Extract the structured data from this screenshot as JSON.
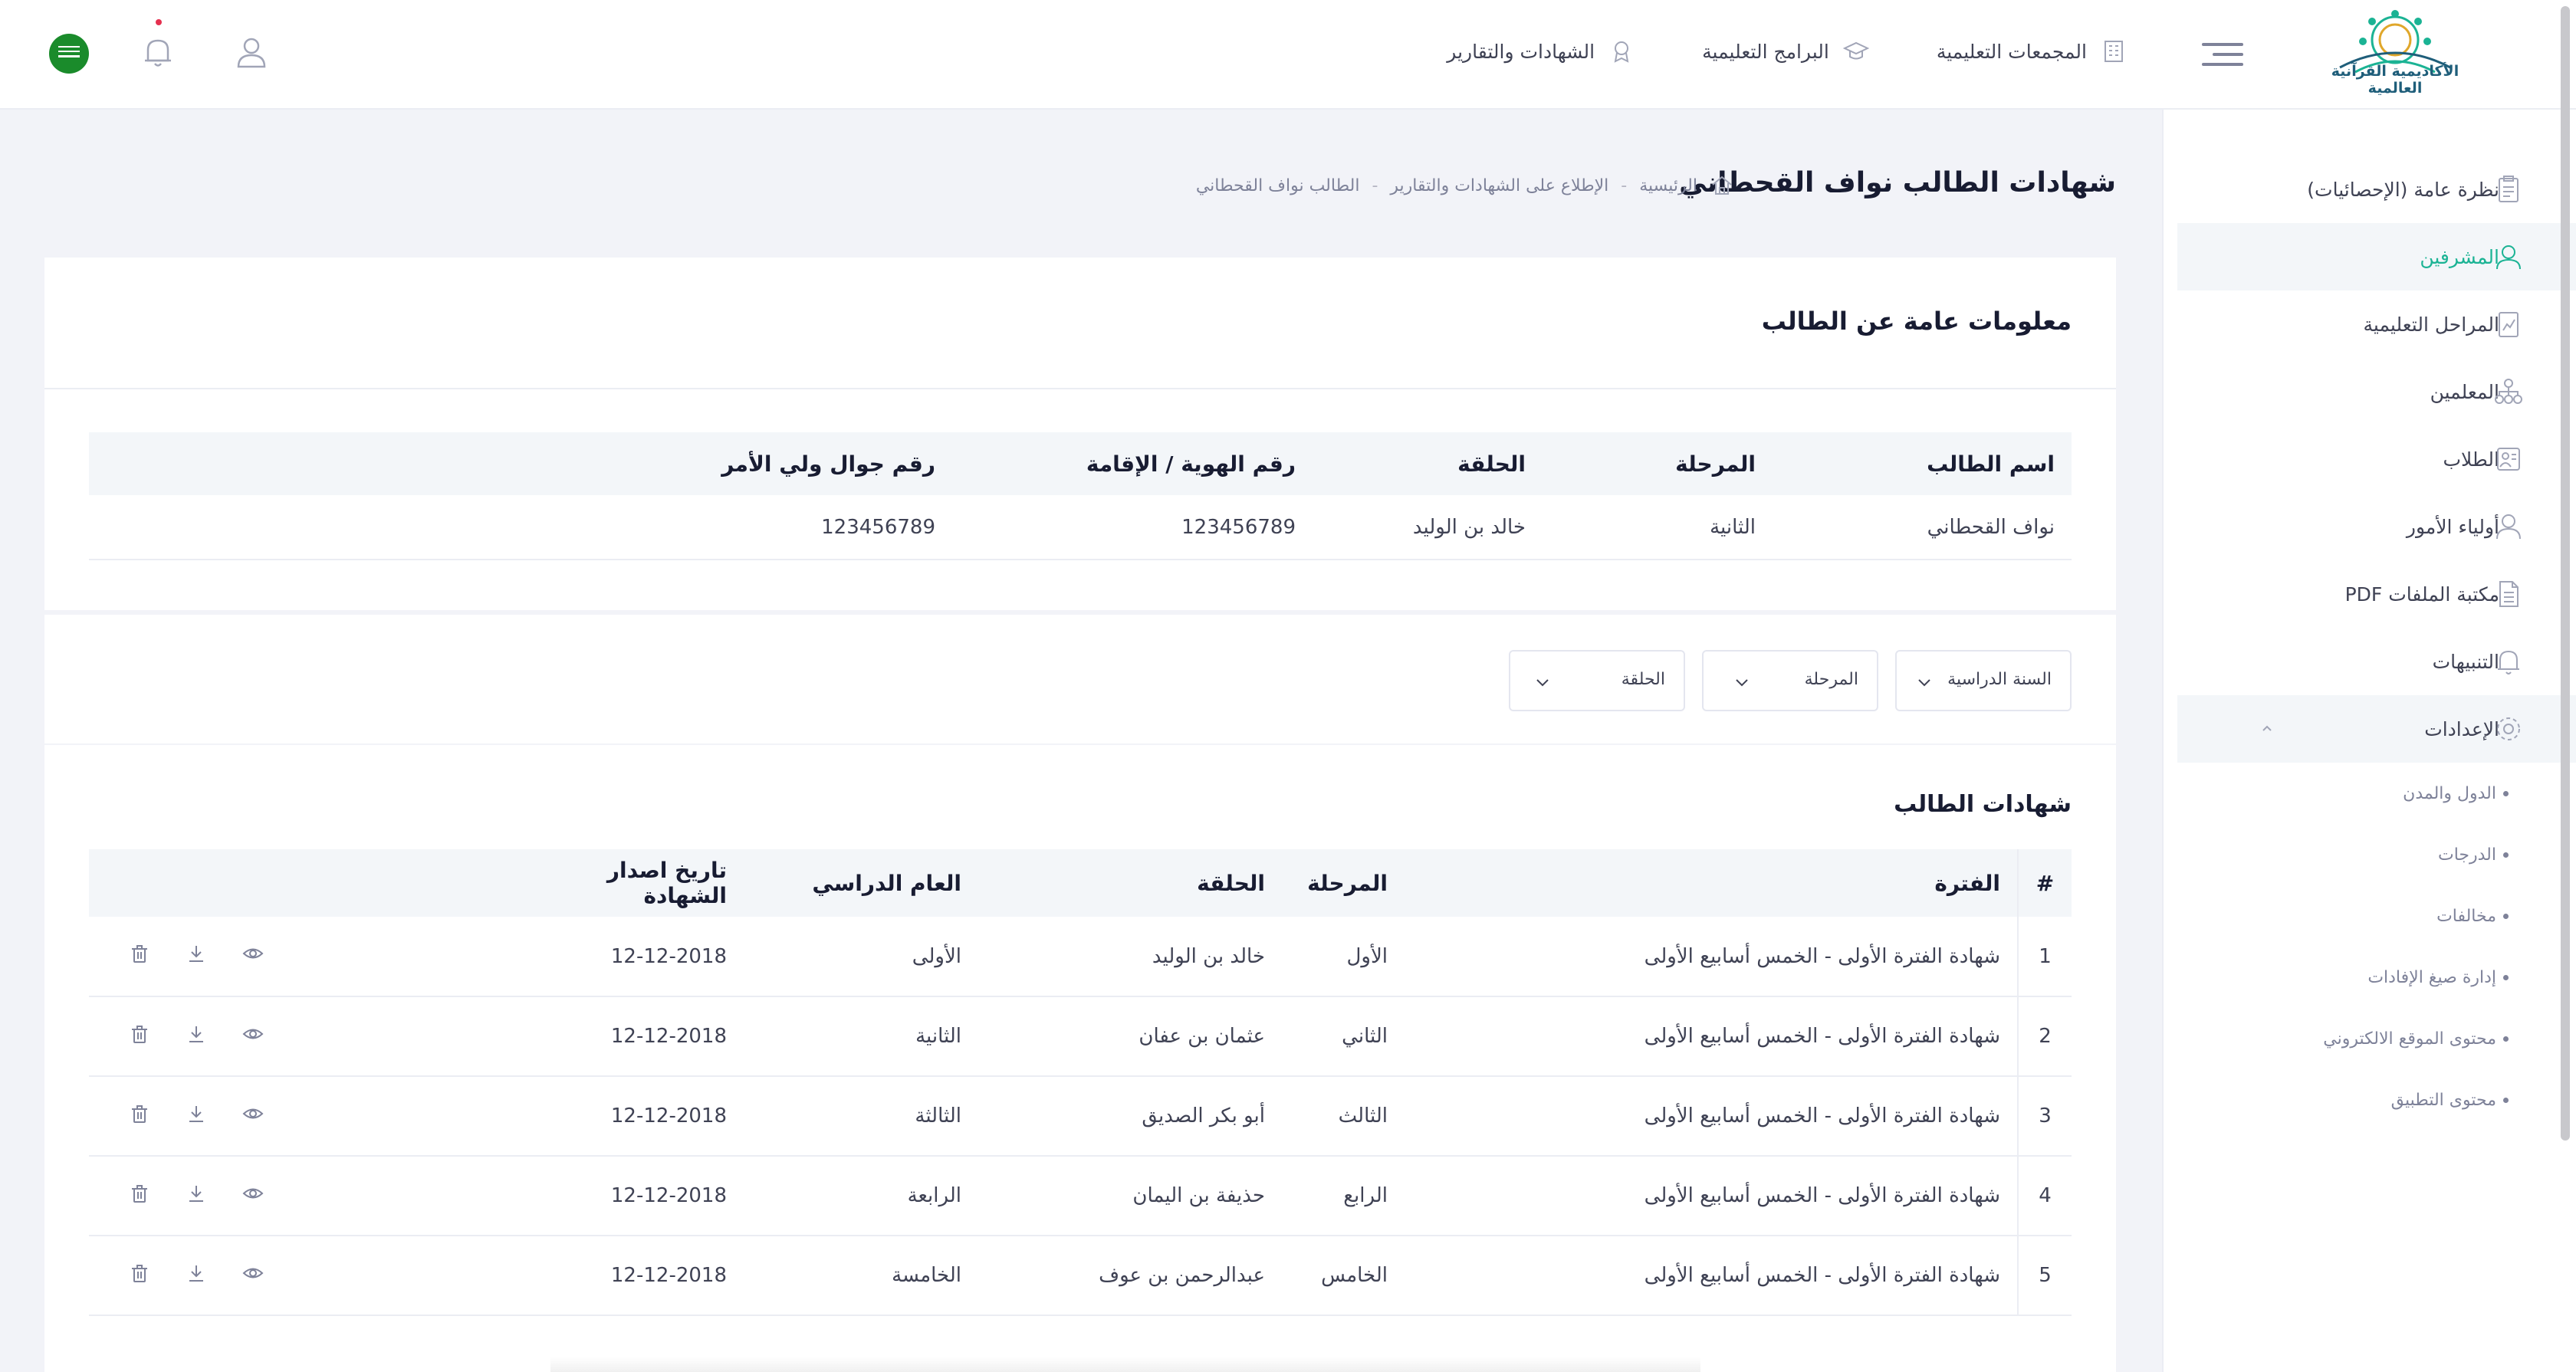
{
  "header": {
    "logo_text": "الأكاديمية القرآنية العالمية",
    "nav": [
      {
        "label": "المجمعات التعليمية",
        "icon": "building-icon"
      },
      {
        "label": "البرامج التعليمية",
        "icon": "graduation-cap-icon"
      },
      {
        "label": "الشهادات والتقارير",
        "icon": "award-icon"
      }
    ]
  },
  "sidebar": {
    "items": [
      {
        "label": "نظرة عامة (الإحصائيات)",
        "icon": "clipboard-icon"
      },
      {
        "label": "المشرفين",
        "icon": "users-icon"
      },
      {
        "label": "المراحل التعليمية",
        "icon": "chart-report-icon"
      },
      {
        "label": "المعلمين",
        "icon": "teachers-network-icon"
      },
      {
        "label": "الطلاب",
        "icon": "students-icon"
      },
      {
        "label": "أولياء الأمور",
        "icon": "parents-icon"
      },
      {
        "label": "مكتبة الملفات PDF",
        "icon": "document-icon"
      },
      {
        "label": "التنبيهات",
        "icon": "bell-icon"
      },
      {
        "label": "الإعدادات",
        "icon": "gear-icon"
      }
    ],
    "sub_items": [
      "الدول والمدن",
      "الدرجات",
      "مخالفات",
      "إدارة صيغ الإفادات",
      "محتوى الموقع الالكتروني",
      "محتوى التطبيق"
    ]
  },
  "page": {
    "title": "شهادات الطالب نواف القحطاني",
    "breadcrumb": [
      "الرئيسية",
      "الإطلاع على الشهادات والتقارير",
      "الطالب نواف القحطاني"
    ]
  },
  "info": {
    "title": "معلومات عامة عن الطالب",
    "headers": [
      "اسم الطالب",
      "المرحلة",
      "الحلقة",
      "رقم الهوية / الإقامة",
      "رقم جوال ولي الأمر"
    ],
    "row": [
      "نواف القحطاني",
      "الثانية",
      "خالد بن الوليد",
      "123456789",
      "123456789"
    ]
  },
  "filters": [
    "السنة الدراسية",
    "المرحلة",
    "الحلقة"
  ],
  "certs": {
    "title": "شهادات الطالب",
    "headers": [
      "#",
      "الفترة",
      "المرحلة",
      "الحلقة",
      "العام الدراسي",
      "تاريخ اصدار الشهادة"
    ],
    "rows": [
      [
        "1",
        "شهادة الفترة الأولى - الخمس أسابيع الأولى",
        "الأول",
        "خالد بن الوليد",
        "الأولى",
        "12-12-2018"
      ],
      [
        "2",
        "شهادة الفترة الأولى - الخمس أسابيع الأولى",
        "الثاني",
        "عثمان بن عفان",
        "الثانية",
        "12-12-2018"
      ],
      [
        "3",
        "شهادة الفترة الأولى - الخمس أسابيع الأولى",
        "الثالث",
        "أبو بكر الصديق",
        "الثالثة",
        "12-12-2018"
      ],
      [
        "4",
        "شهادة الفترة الأولى - الخمس أسابيع الأولى",
        "الرابع",
        "حذيفة بن اليمان",
        "الرابعة",
        "12-12-2018"
      ],
      [
        "5",
        "شهادة الفترة الأولى - الخمس أسابيع الأولى",
        "الخامس",
        "عبدالرحمن بن عوف",
        "الخامسة",
        "12-12-2018"
      ]
    ]
  },
  "colors": {
    "accent": "#1bb394",
    "flag": "#1a8b2b",
    "notification_dot": "#e5304f"
  }
}
